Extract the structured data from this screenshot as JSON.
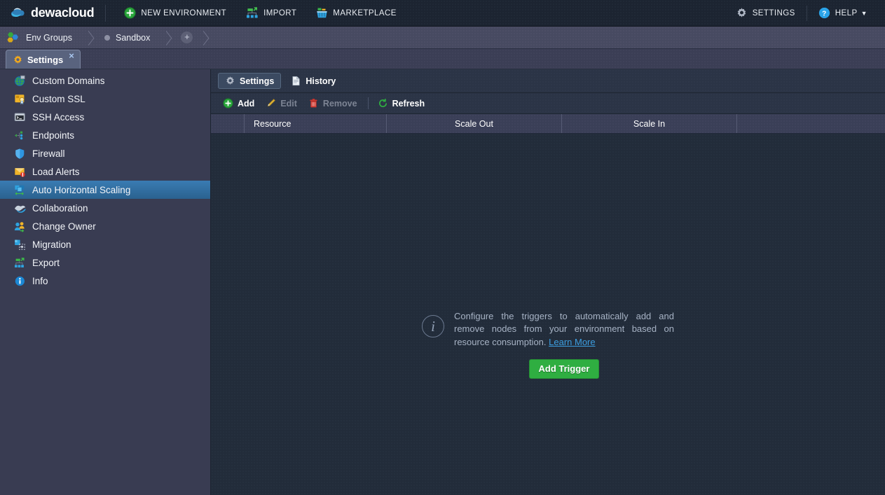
{
  "topbar": {
    "logo_text": "dewacloud",
    "logo_icon": "cloud-logo-icon",
    "nav": [
      {
        "label": "NEW ENVIRONMENT",
        "icon": "plus-circle-green-icon",
        "name": "new-environment"
      },
      {
        "label": "IMPORT",
        "icon": "import-nodes-icon",
        "name": "import"
      },
      {
        "label": "MARKETPLACE",
        "icon": "marketplace-basket-icon",
        "name": "marketplace"
      }
    ],
    "right": [
      {
        "label": "SETTINGS",
        "icon": "gear-icon",
        "name": "settings"
      },
      {
        "label": "HELP",
        "icon": "question-circle-icon",
        "name": "help",
        "caret": "▼"
      }
    ]
  },
  "breadcrumb": {
    "items": [
      {
        "label": "Env Groups",
        "icon": "env-groups-icon",
        "name": "breadcrumb-env-groups"
      },
      {
        "label": "Sandbox",
        "icon": "status-dot-icon",
        "name": "breadcrumb-sandbox"
      }
    ],
    "add_label": "+"
  },
  "tabs": [
    {
      "label": "Settings",
      "icon": "gear-orange-icon",
      "close": "×",
      "active": true
    }
  ],
  "sidebar": {
    "items": [
      {
        "label": "Custom Domains",
        "icon": "globe-icon",
        "name": "sidebar-item-custom-domains",
        "active": false
      },
      {
        "label": "Custom SSL",
        "icon": "certificate-icon",
        "name": "sidebar-item-custom-ssl",
        "active": false
      },
      {
        "label": "SSH Access",
        "icon": "terminal-icon",
        "name": "sidebar-item-ssh-access",
        "active": false
      },
      {
        "label": "Endpoints",
        "icon": "endpoints-icon",
        "name": "sidebar-item-endpoints",
        "active": false
      },
      {
        "label": "Firewall",
        "icon": "shield-icon",
        "name": "sidebar-item-firewall",
        "active": false
      },
      {
        "label": "Load Alerts",
        "icon": "load-alerts-icon",
        "name": "sidebar-item-load-alerts",
        "active": false
      },
      {
        "label": "Auto Horizontal Scaling",
        "icon": "horizontal-scaling-icon",
        "name": "sidebar-item-auto-horizontal-scaling",
        "active": true
      },
      {
        "label": "Collaboration",
        "icon": "handshake-icon",
        "name": "sidebar-item-collaboration",
        "active": false
      },
      {
        "label": "Change Owner",
        "icon": "change-owner-icon",
        "name": "sidebar-item-change-owner",
        "active": false
      },
      {
        "label": "Migration",
        "icon": "migration-icon",
        "name": "sidebar-item-migration",
        "active": false
      },
      {
        "label": "Export",
        "icon": "export-icon",
        "name": "sidebar-item-export",
        "active": false
      },
      {
        "label": "Info",
        "icon": "info-circle-icon",
        "name": "sidebar-item-info",
        "active": false
      }
    ]
  },
  "main": {
    "subtabs": [
      {
        "label": "Settings",
        "icon": "gear-icon",
        "name": "tab-settings",
        "active": true
      },
      {
        "label": "History",
        "icon": "document-icon",
        "name": "tab-history",
        "active": false
      }
    ],
    "toolbar": [
      {
        "label": "Add",
        "icon": "plus-circle-green-icon",
        "name": "add-button",
        "disabled": false
      },
      {
        "label": "Edit",
        "icon": "pencil-icon",
        "name": "edit-button",
        "disabled": true
      },
      {
        "label": "Remove",
        "icon": "trash-icon",
        "name": "remove-button",
        "disabled": true
      },
      {
        "label": "Refresh",
        "icon": "refresh-icon",
        "name": "refresh-button",
        "disabled": false
      }
    ],
    "table": {
      "columns": [
        "",
        "Resource",
        "Scale Out",
        "Scale In",
        ""
      ],
      "rows": []
    },
    "empty_state": {
      "icon": "info-circle-icon",
      "text_before": "Configure the triggers to automatically add and remove nodes from your environment based on resource consumption. ",
      "link_label": "Learn More",
      "button_label": "Add Trigger"
    }
  },
  "colors": {
    "accent_green": "#2fae41",
    "link_blue": "#3c9ee0",
    "selection_blue": "#2f6ba0",
    "sidebar_bg": "#393c52",
    "topbar_bg": "#1c2431",
    "content_bg": "#222c3a"
  }
}
